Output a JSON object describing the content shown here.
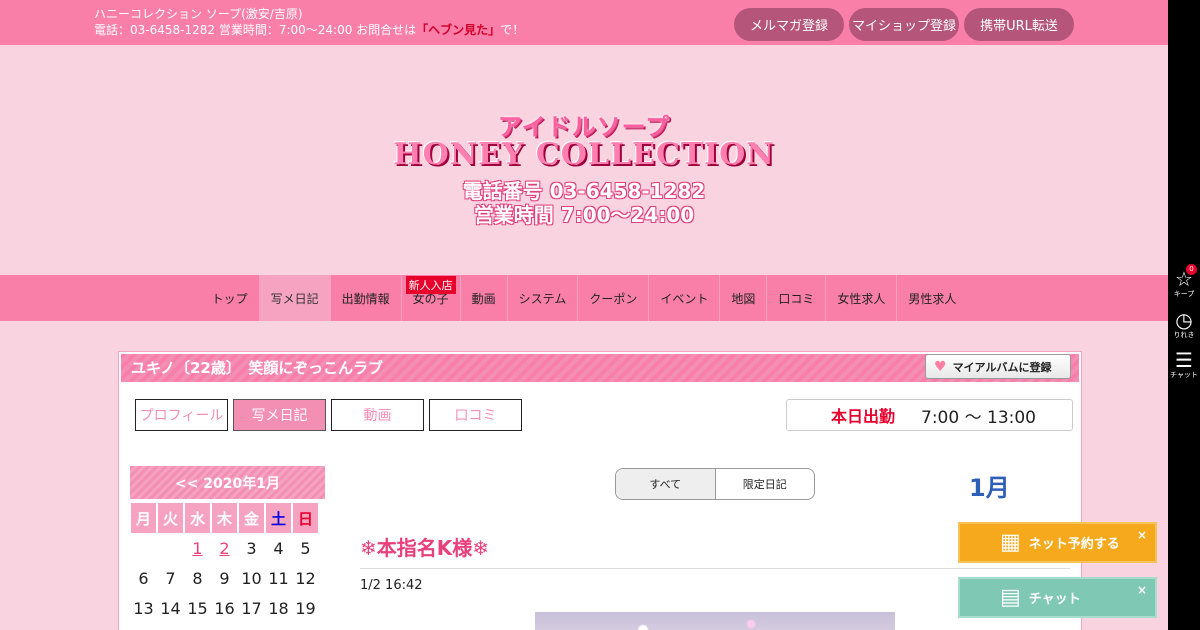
{
  "topbar": {
    "shop_line": "ハニーコレクション ソープ(激安/吉原)",
    "contact_prefix": "電話：03-6458-1282 営業時間：7:00～24:00 お問合せは",
    "contact_heaven": "「ヘブン見た」",
    "contact_suffix": "で！",
    "buttons": [
      "メルマガ登録",
      "マイショップ登録",
      "携帯URL転送"
    ]
  },
  "logo": {
    "sub": "アイドルソープ",
    "main": "HONEY COLLECTION",
    "tel": "電話番号 03-6458-1282",
    "hours": "営業時間 7:00〜24:00"
  },
  "nav": {
    "items": [
      "トップ",
      "写メ日記",
      "出勤情報",
      "女の子",
      "動画",
      "システム",
      "クーポン",
      "イベント",
      "地図",
      "口コミ",
      "女性求人",
      "男性求人"
    ],
    "active": "写メ日記",
    "new_badge": "新人入店"
  },
  "profile": {
    "title": "ユキノ〔22歳〕　笑顔にぞっこんラブ",
    "album_button": "マイアルバムに登録",
    "tabs": [
      "プロフィール",
      "写メ日記",
      "動画",
      "口コミ"
    ],
    "today_label": "本日出勤",
    "today_time": "7:00 ～ 13:00"
  },
  "calendar": {
    "header": "<< 2020年1月",
    "weekdays": [
      "月",
      "火",
      "水",
      "木",
      "金",
      "土",
      "日"
    ],
    "days": [
      "",
      "",
      "1",
      "2",
      "3",
      "4",
      "5",
      "6",
      "7",
      "8",
      "9",
      "10",
      "11",
      "12",
      "13",
      "14",
      "15",
      "16",
      "17",
      "18",
      "19"
    ],
    "linked_days": [
      "1",
      "2"
    ]
  },
  "diary": {
    "filter_all": "すべて",
    "filter_limited": "限定日記",
    "month": "1月",
    "entry_title": "❄本指名K様❄",
    "entry_date": "1/2 16:42"
  },
  "sidebar": {
    "keep_label": "キープ",
    "keep_count": "0",
    "history_label": "りれき",
    "chat_label": "チャット"
  },
  "fabs": {
    "reserve": "ネット予約する",
    "chat": "チャット",
    "close": "×"
  }
}
